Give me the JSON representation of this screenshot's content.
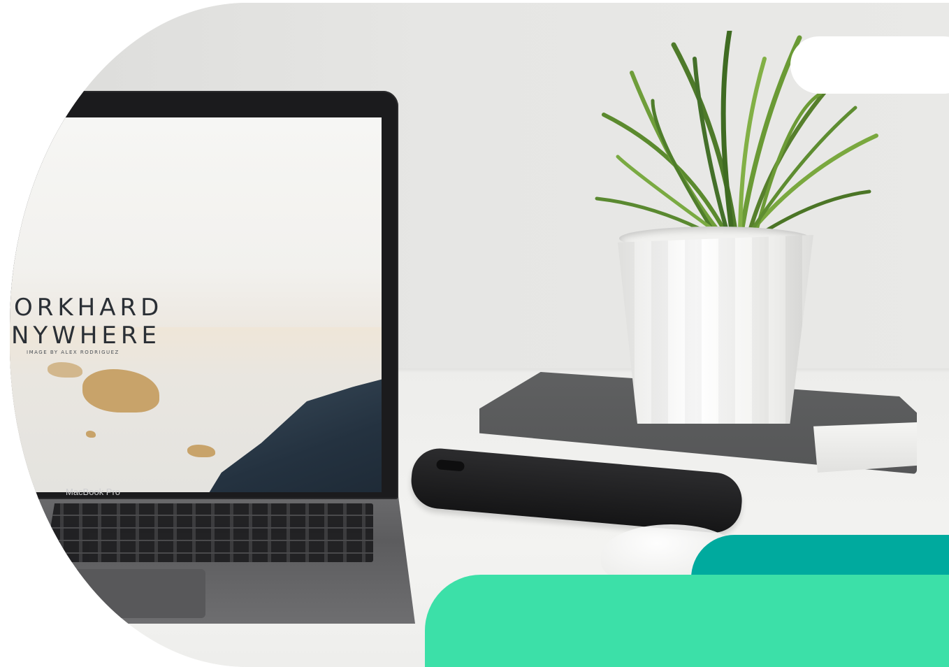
{
  "laptop": {
    "screen_title_line1": "ORKHARD",
    "screen_title_line2": "NYWHERE",
    "screen_credit": "IMAGE BY ALEX RODRIGUEZ",
    "brand": "MacBook Pro"
  },
  "colors": {
    "accent_green": "#3ce0a8",
    "accent_teal": "#00aa9e",
    "white_pill": "#ffffff"
  }
}
